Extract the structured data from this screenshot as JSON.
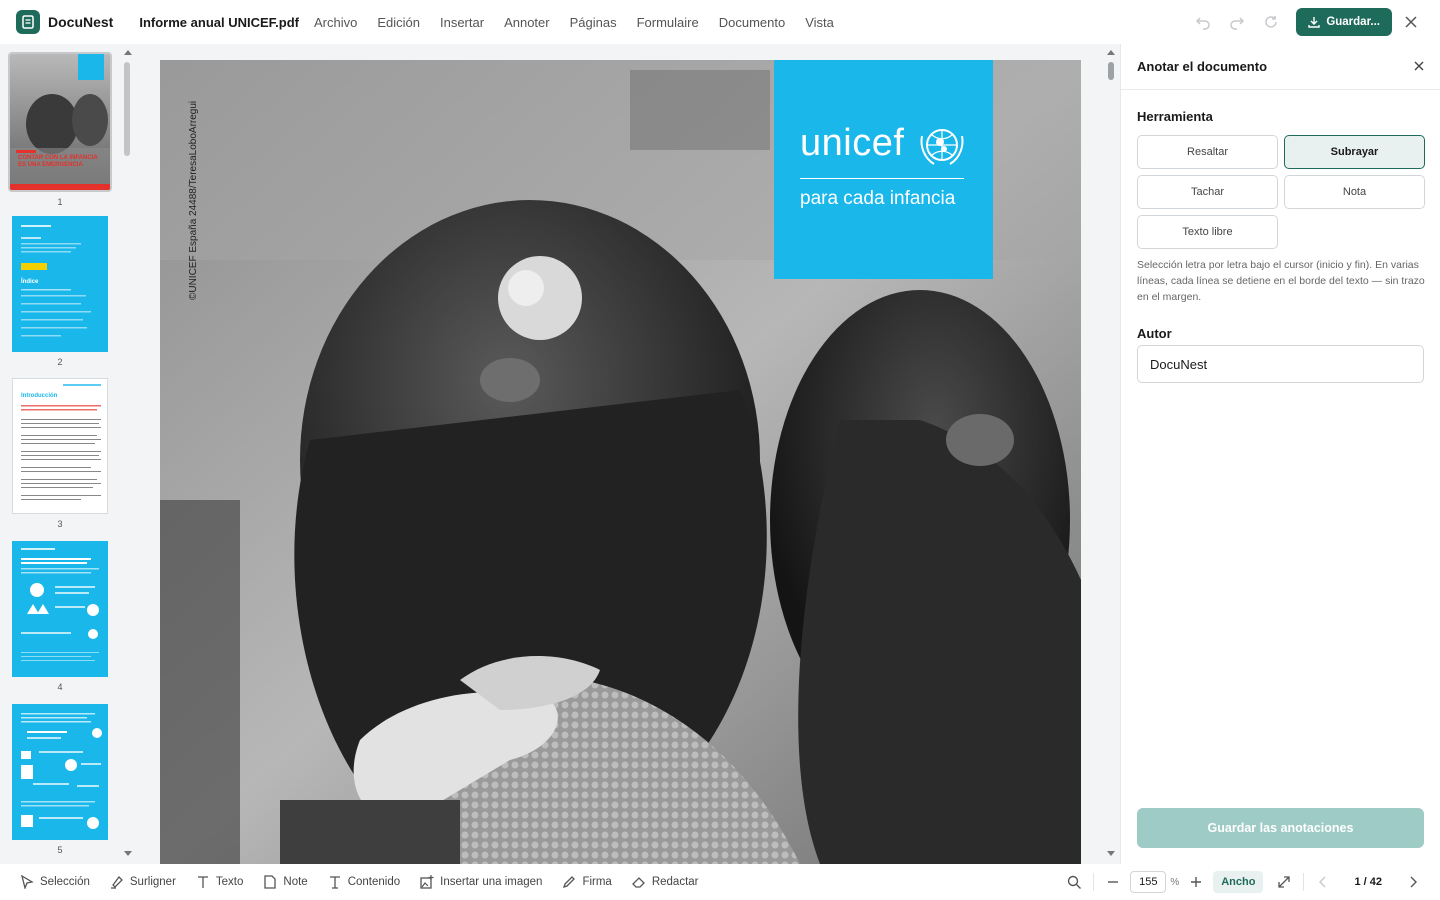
{
  "app": {
    "name": "DocuNest",
    "filename": "Informe anual UNICEF.pdf"
  },
  "menu": [
    "Archivo",
    "Edición",
    "Insertar",
    "Annoter",
    "Páginas",
    "Formulaire",
    "Documento",
    "Vista"
  ],
  "toolbar": {
    "save_label": "Guardar..."
  },
  "thumbnails": [
    {
      "num": "1",
      "kind": "cover",
      "cover_text": "CONTAR CON LA INFANCIA ES UNA EMERGENCIA"
    },
    {
      "num": "2",
      "kind": "blue-index",
      "title": "Índice"
    },
    {
      "num": "3",
      "kind": "white-intro",
      "title": "Introducción"
    },
    {
      "num": "4",
      "kind": "blue-infographic"
    },
    {
      "num": "5",
      "kind": "blue-infographic"
    }
  ],
  "document": {
    "credit": "©UNICEF España 24488/TeresaLoboArregui",
    "brand_word": "unicef",
    "brand_tagline": "para cada infancia",
    "brand_color": "#1ab7ea"
  },
  "panel": {
    "title": "Anotar el documento",
    "tool_section": "Herramienta",
    "tools": [
      {
        "label": "Resaltar",
        "selected": false
      },
      {
        "label": "Subrayar",
        "selected": true
      },
      {
        "label": "Tachar",
        "selected": false
      },
      {
        "label": "Nota",
        "selected": false
      },
      {
        "label": "Texto libre",
        "selected": false
      }
    ],
    "help": "Selección letra por letra bajo el cursor (inicio y fin). En varias líneas, cada línea se detiene en el borde del texto — sin trazo en el margen.",
    "author_label": "Autor",
    "author_value": "DocuNest",
    "save_annotations": "Guardar las anotaciones"
  },
  "bottom_tools": [
    {
      "label": "Selección",
      "icon": "cursor-icon"
    },
    {
      "label": "Surligner",
      "icon": "highlighter-icon"
    },
    {
      "label": "Texto",
      "icon": "text-icon"
    },
    {
      "label": "Note",
      "icon": "note-icon"
    },
    {
      "label": "Contenido",
      "icon": "content-text-icon"
    },
    {
      "label": "Insertar una imagen",
      "icon": "image-add-icon"
    },
    {
      "label": "Firma",
      "icon": "pen-icon"
    },
    {
      "label": "Redactar",
      "icon": "eraser-icon"
    }
  ],
  "zoom": {
    "value": "155",
    "unit": "%",
    "fit_label": "Ancho"
  },
  "pagination": {
    "indicator": "1 / 42"
  },
  "colors": {
    "accent": "#1e6b5c",
    "accent_light": "#e8f1ef",
    "save_disabled": "#9fcbc6"
  }
}
